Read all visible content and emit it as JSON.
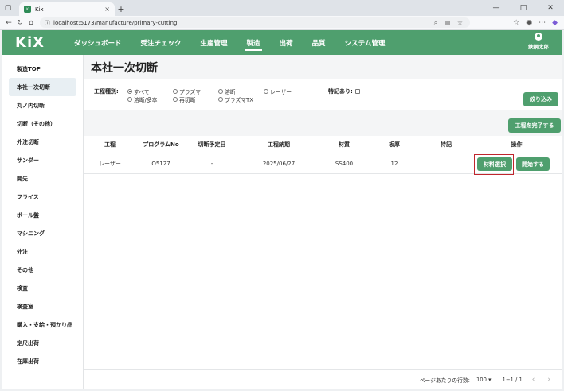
{
  "browser": {
    "tab_title": "Kix",
    "url": "localhost:5173/manufacture/primary-cutting",
    "tab_close": "×",
    "new_tab": "+",
    "minimize": "—",
    "maximize": "□",
    "close": "✕"
  },
  "app": {
    "logo": "KiX",
    "nav": [
      {
        "label": "ダッシュボード"
      },
      {
        "label": "受注チェック"
      },
      {
        "label": "生産管理"
      },
      {
        "label": "製造",
        "active": true
      },
      {
        "label": "出荷"
      },
      {
        "label": "品質"
      },
      {
        "label": "システム管理"
      }
    ],
    "user_name": "鉄鋼太郎"
  },
  "sidebar": {
    "items": [
      {
        "label": "製造TOP"
      },
      {
        "label": "本社一次切断",
        "active": true
      },
      {
        "label": "丸ノ内切断"
      },
      {
        "label": "切断（その他）"
      },
      {
        "label": "外注切断"
      },
      {
        "label": "サンダー"
      },
      {
        "label": "開先"
      },
      {
        "label": "フライス"
      },
      {
        "label": "ボール盤"
      },
      {
        "label": "マシニング"
      },
      {
        "label": "外注"
      },
      {
        "label": "その他"
      },
      {
        "label": "検査"
      },
      {
        "label": "検査室"
      },
      {
        "label": "購入・支給・預かり品"
      },
      {
        "label": "定尺出荷"
      },
      {
        "label": "在庫出荷"
      }
    ]
  },
  "page": {
    "title": "本社一次切断",
    "filter": {
      "process_label": "工程種別:",
      "options": [
        {
          "label": "すべて",
          "checked": true
        },
        {
          "label": "プラズマ",
          "checked": false
        },
        {
          "label": "溶断",
          "checked": false
        },
        {
          "label": "レーザー",
          "checked": false
        },
        {
          "label": "溶断/多本",
          "checked": false
        },
        {
          "label": "再切断",
          "checked": false
        },
        {
          "label": "プラズマTX",
          "checked": false
        }
      ],
      "remark_label": "特記あり:",
      "filter_button": "絞り込み"
    },
    "complete_button": "工程を完了する",
    "table": {
      "headers": [
        "工程",
        "プログラムNo",
        "切断予定日",
        "工程納期",
        "材質",
        "板厚",
        "特記",
        "操作"
      ],
      "rows": [
        {
          "process": "レーザー",
          "program_no": "O5127",
          "planned_date": "-",
          "deadline": "2025/06/27",
          "material": "SS400",
          "thickness": "12",
          "remark": "",
          "select_button": "材料選択",
          "start_button": "開始する"
        }
      ]
    },
    "pager": {
      "rows_label": "ページあたりの行数:",
      "rows_value": "100 ▾",
      "range": "1−1 / 1",
      "prev": "‹",
      "next": "›"
    }
  },
  "colors": {
    "brand_green": "#4f9f6e",
    "highlight_red": "#c0262d"
  }
}
